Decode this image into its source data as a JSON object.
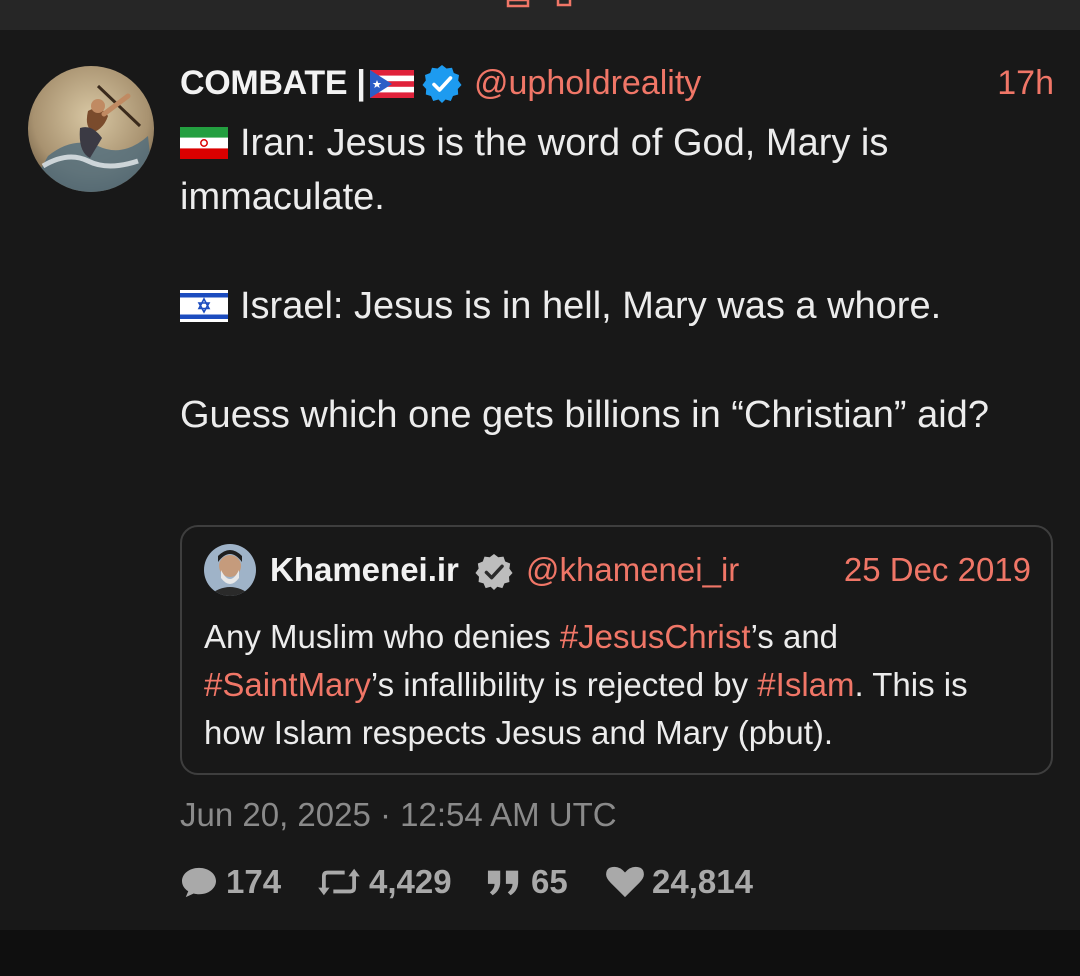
{
  "post": {
    "author": {
      "name": "COMBATE |",
      "flag": "Puerto Rico flag",
      "handle": "@upholdreality",
      "verified": "blue-check-icon"
    },
    "age": "17h",
    "body": [
      {
        "flag": "Iran flag",
        "text": "Iran: Jesus is the word of God, Mary is immaculate."
      },
      {
        "flag": "Israel flag",
        "text": "Israel: Jesus is in hell, Mary was a whore."
      },
      {
        "flag": "",
        "text": "Guess which one gets billions in “Christian” aid?"
      }
    ],
    "quote": {
      "name": "Khamenei.ir",
      "verified": "gray-check-icon",
      "handle": "@khamenei_ir",
      "date": "25 Dec 2019",
      "segments": [
        {
          "text": "Any Muslim who denies ",
          "hashtag": false
        },
        {
          "text": "#JesusChrist",
          "hashtag": true
        },
        {
          "text": "’s and ",
          "hashtag": false
        },
        {
          "text": "#SaintMary",
          "hashtag": true
        },
        {
          "text": "’s infallibility is rejected by ",
          "hashtag": false
        },
        {
          "text": "#Islam",
          "hashtag": true
        },
        {
          "text": ". This is how Islam respects Jesus and Mary (pbut).",
          "hashtag": false
        }
      ]
    },
    "timestamp": "Jun 20, 2025 · 12:54 AM UTC",
    "stats": {
      "replies": "174",
      "reposts": "4,429",
      "quotes": "65",
      "likes": "24,814"
    }
  },
  "colors": {
    "background": "#181818",
    "accent": "#f07667",
    "text": "#ececec",
    "muted": "#8a8a8a",
    "verified_blue": "#1d9bf0"
  },
  "icons": [
    "speech-bubble-icon",
    "repost-icon",
    "quote-icon",
    "heart-icon"
  ]
}
